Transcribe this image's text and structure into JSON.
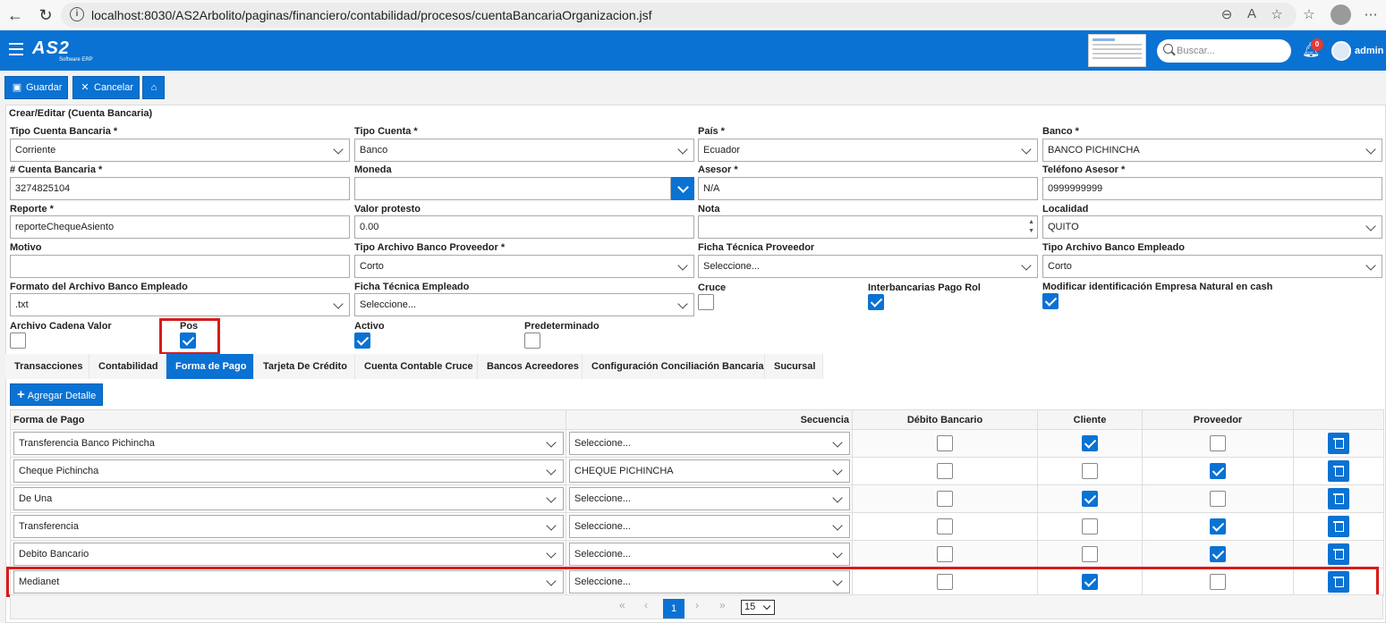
{
  "browser": {
    "url": "localhost:8030/AS2Arbolito/paginas/financiero/contabilidad/procesos/cuentaBancariaOrganizacion.jsf"
  },
  "header": {
    "logo": "AS2",
    "logo_sub": "Software ERP",
    "search_placeholder": "Buscar...",
    "notifications": "0",
    "user": "admin",
    "brand_color": "#0a72d3"
  },
  "toolbar": {
    "save": "Guardar",
    "cancel": "Cancelar"
  },
  "form": {
    "title": "Crear/Editar (Cuenta Bancaria)",
    "tipo_cuenta_bancaria": {
      "label": "Tipo Cuenta Bancaria *",
      "value": "Corriente"
    },
    "tipo_cuenta": {
      "label": "Tipo Cuenta *",
      "value": "Banco"
    },
    "pais": {
      "label": "País *",
      "value": "Ecuador"
    },
    "banco": {
      "label": "Banco *",
      "value": "BANCO PICHINCHA"
    },
    "numero_cuenta": {
      "label": "# Cuenta Bancaria *",
      "value": "3274825104"
    },
    "moneda": {
      "label": "Moneda",
      "value": ""
    },
    "asesor": {
      "label": "Asesor *",
      "value": "N/A"
    },
    "telefono_asesor": {
      "label": "Teléfono Asesor *",
      "value": "0999999999"
    },
    "reporte": {
      "label": "Reporte *",
      "value": "reporteChequeAsiento"
    },
    "valor_protesto": {
      "label": "Valor protesto",
      "value": "0.00"
    },
    "nota": {
      "label": "Nota",
      "value": ""
    },
    "localidad": {
      "label": "Localidad",
      "value": "QUITO"
    },
    "motivo": {
      "label": "Motivo",
      "value": ""
    },
    "tipo_archivo_proveedor": {
      "label": "Tipo Archivo Banco Proveedor *",
      "value": "Corto"
    },
    "ficha_tecnica_proveedor": {
      "label": "Ficha Técnica Proveedor",
      "value": "Seleccione..."
    },
    "tipo_archivo_empleado": {
      "label": "Tipo Archivo Banco Empleado",
      "value": "Corto"
    },
    "formato_archivo_empleado": {
      "label": "Formato del Archivo Banco Empleado",
      "value": ".txt"
    },
    "ficha_tecnica_empleado": {
      "label": "Ficha Técnica Empleado",
      "value": "Seleccione..."
    },
    "cruce": {
      "label": "Cruce",
      "checked": false
    },
    "interbancarias": {
      "label": "Interbancarias Pago Rol",
      "checked": true
    },
    "modificar_id": {
      "label": "Modificar identificación Empresa Natural en cash",
      "checked": true
    },
    "archivo_cadena_valor": {
      "label": "Archivo Cadena Valor",
      "checked": false
    },
    "pos": {
      "label": "Pos",
      "checked": true
    },
    "activo": {
      "label": "Activo",
      "checked": true
    },
    "predeterminado": {
      "label": "Predeterminado",
      "checked": false
    }
  },
  "tabs": [
    "Transacciones",
    "Contabilidad",
    "Forma de Pago",
    "Tarjeta De Crédito",
    "Cuenta Contable Cruce",
    "Bancos Acreedores",
    "Configuración Conciliación Bancaria",
    "Sucursal"
  ],
  "active_tab": "Forma de Pago",
  "add_button": "Agregar Detalle",
  "table": {
    "headers": [
      "Forma de Pago",
      "Secuencia",
      "Débito Bancario",
      "Cliente",
      "Proveedor",
      ""
    ],
    "rows": [
      {
        "forma": "Transferencia Banco Pichincha",
        "secuencia": "Seleccione...",
        "debito": false,
        "cliente": true,
        "proveedor": false
      },
      {
        "forma": "Cheque Pichincha",
        "secuencia": "CHEQUE PICHINCHA",
        "debito": false,
        "cliente": false,
        "proveedor": true
      },
      {
        "forma": "De Una",
        "secuencia": "Seleccione...",
        "debito": false,
        "cliente": true,
        "proveedor": false
      },
      {
        "forma": "Transferencia",
        "secuencia": "Seleccione...",
        "debito": false,
        "cliente": false,
        "proveedor": true
      },
      {
        "forma": "Debito Bancario",
        "secuencia": "Seleccione...",
        "debito": false,
        "cliente": false,
        "proveedor": true
      },
      {
        "forma": "Medianet",
        "secuencia": "Seleccione...",
        "debito": false,
        "cliente": true,
        "proveedor": false
      }
    ]
  },
  "paginator": {
    "current_page": "1",
    "rows_per_page": "15"
  }
}
